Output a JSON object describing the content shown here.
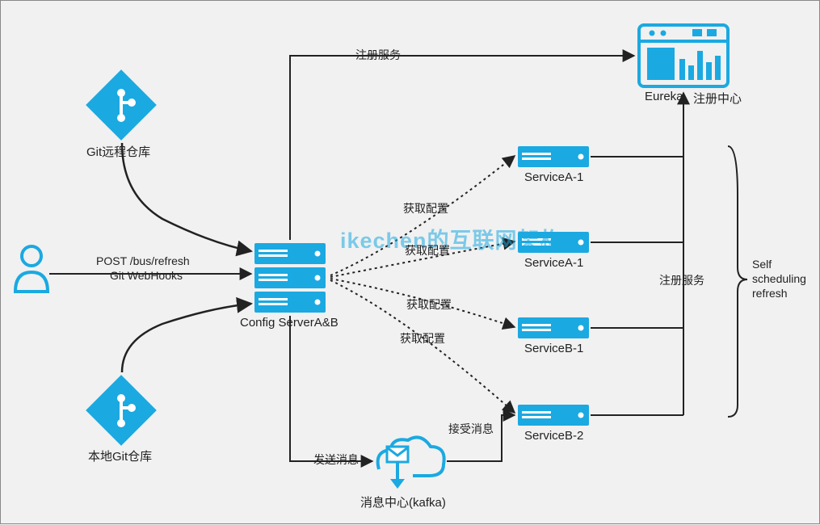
{
  "nodes": {
    "git_remote": "Git远程仓库",
    "git_local": "本地Git仓库",
    "config_server": "Config ServerA&B",
    "service_a1": "ServiceA-1",
    "service_a2": "ServiceA-1",
    "service_b1": "ServiceB-1",
    "service_b2": "ServiceB-2",
    "eureka": "Eureka",
    "eureka_sub": "注册中心",
    "mq": "消息中心(kafka)"
  },
  "edges": {
    "post_refresh_line1": "POST /bus/refresh",
    "post_refresh_line2": "Git WebHooks",
    "register_service_top": "注册服务",
    "register_service_right": "注册服务",
    "get_config_1": "获取配置",
    "get_config_2": "获取配置",
    "get_config_3": "获取配置",
    "get_config_4": "获取配置",
    "send_msg": "发送消息",
    "recv_msg": "接受消息",
    "self_refresh_line1": "Self",
    "self_refresh_line2": "scheduling",
    "self_refresh_line3": "refresh"
  },
  "watermark": "ikechen的互联网架构",
  "colors": {
    "accent": "#1ba9e1",
    "line": "#222222"
  }
}
